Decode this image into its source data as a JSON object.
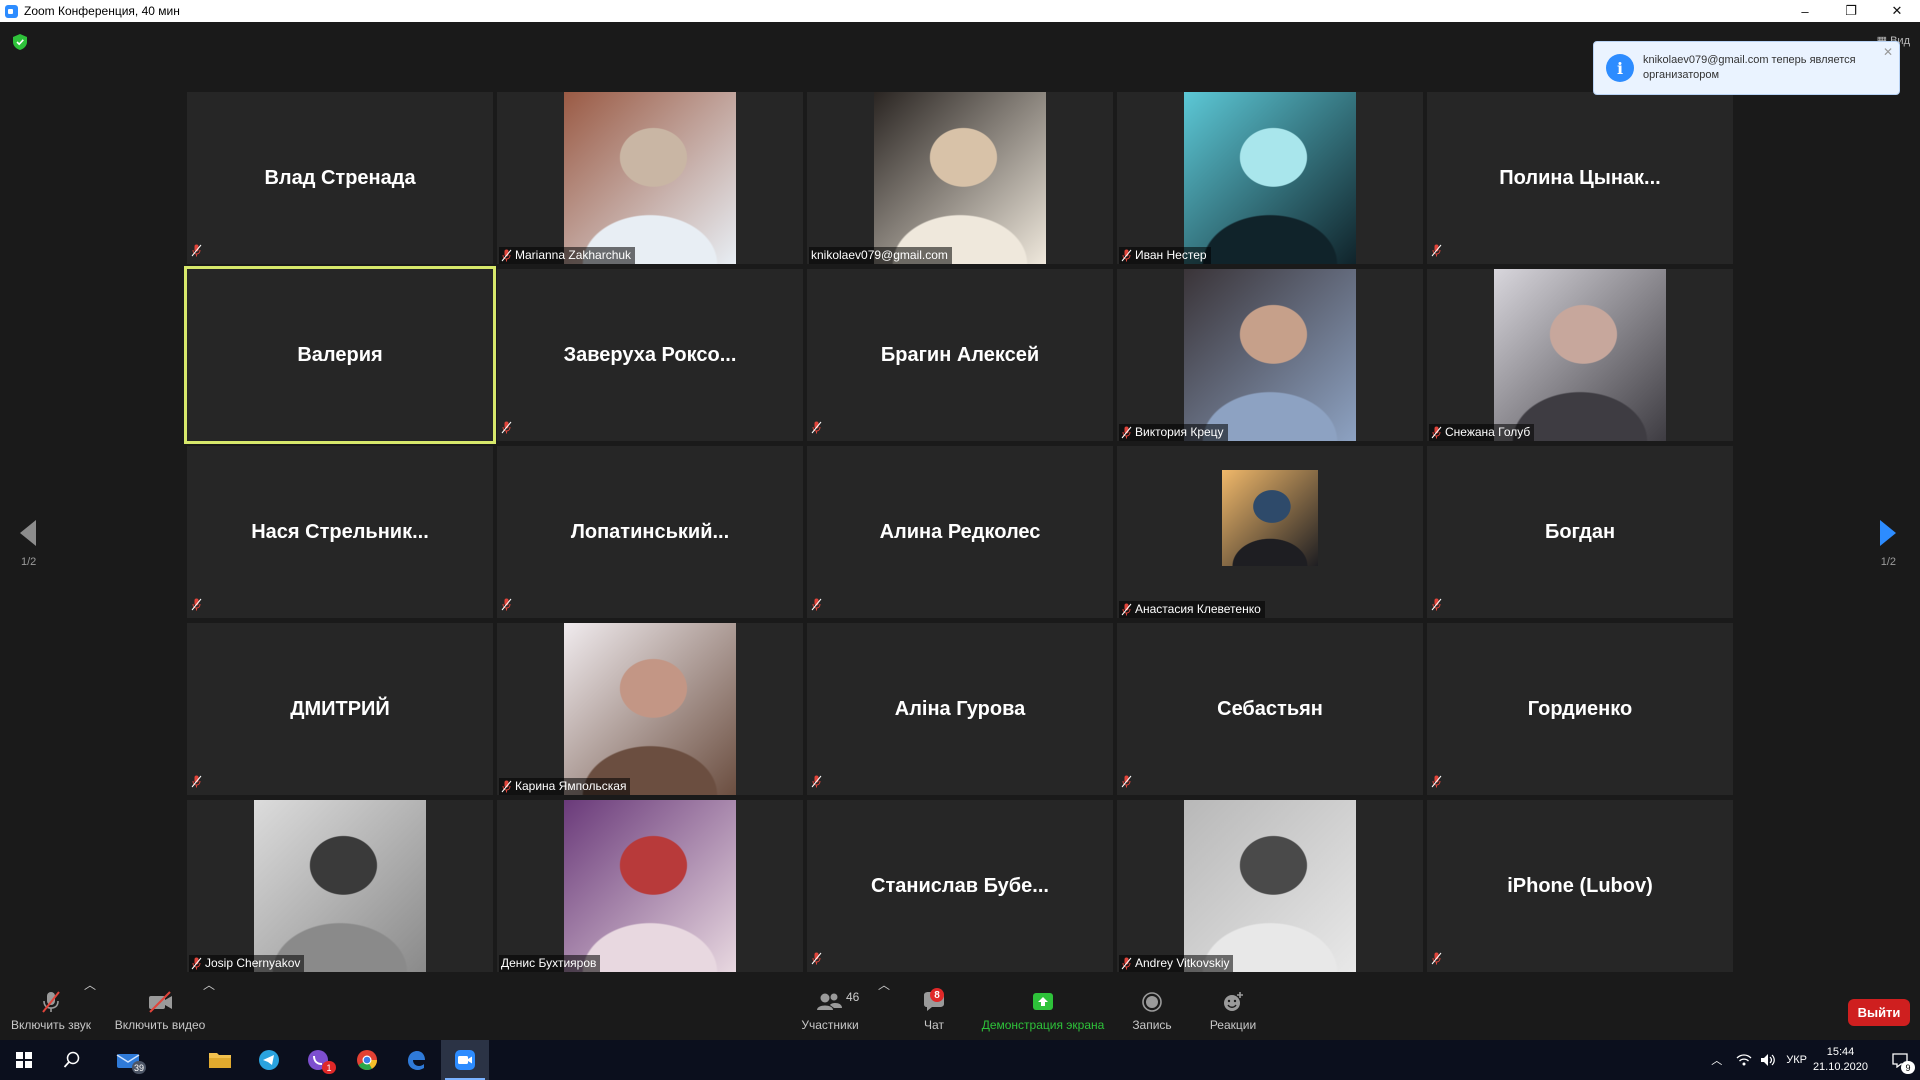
{
  "window": {
    "title": "Zoom Конференция, 40 мин",
    "controls": [
      "–",
      "❐",
      "✕"
    ]
  },
  "toast": {
    "message": "knikolaev079@gmail.com теперь является организатором",
    "close": "✕"
  },
  "view_button": "Вид",
  "pagination": {
    "left": "1/2",
    "right": "1/2"
  },
  "participants": [
    {
      "name": "Влад Стренада",
      "type": "name"
    },
    {
      "name": "Marianna Zakharchuk",
      "type": "photo",
      "palette": [
        "#9a5a44",
        "#c9b6a4",
        "#e8eef4"
      ]
    },
    {
      "name": "knikolaev079@gmail.com",
      "type": "photo",
      "palette": [
        "#2a2522",
        "#d8c2a8",
        "#efe8dc"
      ]
    },
    {
      "name": "Иван Нестер",
      "type": "photo",
      "palette": [
        "#5cc8d6",
        "#a9e6ec",
        "#10232a"
      ]
    },
    {
      "name": "Полина  Цынак...",
      "type": "name"
    },
    {
      "name": "Валерия",
      "type": "name",
      "active": true
    },
    {
      "name": "Заверуха  Роксо...",
      "type": "name"
    },
    {
      "name": "Брагин Алексей",
      "type": "name"
    },
    {
      "name": "Виктория Крецу",
      "type": "photo",
      "palette": [
        "#3a3438",
        "#c6a08a",
        "#8da2c2"
      ]
    },
    {
      "name": "Снежана Голуб",
      "type": "photo",
      "palette": [
        "#d8d6dc",
        "#c7a79c",
        "#3e3c42"
      ]
    },
    {
      "name": "Нася  Стрельник...",
      "type": "name"
    },
    {
      "name": "Лопатинський...",
      "type": "name"
    },
    {
      "name": "Алина Редколес",
      "type": "name"
    },
    {
      "name": "Анастасия Клеветенко",
      "type": "photo-small",
      "palette": [
        "#f0b86a",
        "#2e4a6a",
        "#1e1e22"
      ]
    },
    {
      "name": "Богдан",
      "type": "name"
    },
    {
      "name": "ДМИТРИЙ",
      "type": "name"
    },
    {
      "name": "Карина Ямпольская",
      "type": "photo",
      "palette": [
        "#f0ebee",
        "#c39685",
        "#6b4e40"
      ]
    },
    {
      "name": "Аліна Гурова",
      "type": "name"
    },
    {
      "name": "Себастьян",
      "type": "name"
    },
    {
      "name": "Гордиенко",
      "type": "name"
    },
    {
      "name": "Josip Chernyakov",
      "type": "photo",
      "palette": [
        "#dcdcdc",
        "#3a3a3a",
        "#8a8a8a"
      ]
    },
    {
      "name": "Денис Бухтияров",
      "type": "photo",
      "palette": [
        "#6a3a7a",
        "#b83a3a",
        "#e8d8e0"
      ]
    },
    {
      "name": "Станислав  Бубе...",
      "type": "name"
    },
    {
      "name": "Andrey Vitkovskiy",
      "type": "photo",
      "palette": [
        "#b8b8b8",
        "#4a4a4a",
        "#e8e8e8"
      ]
    },
    {
      "name": "iPhone (Lubov)",
      "type": "name"
    }
  ],
  "toolbar": {
    "unmute_label": "Включить звук",
    "start_video_label": "Включить видео",
    "participants_label": "Участники",
    "participants_count": "46",
    "chat_label": "Чат",
    "chat_badge": "8",
    "share_label": "Демонстрация экрана",
    "record_label": "Запись",
    "reactions_label": "Реакции",
    "leave_label": "Выйти"
  },
  "taskbar": {
    "mail_badge": "39",
    "viber_badge": "1",
    "language": "УКР",
    "time": "15:44",
    "date": "21.10.2020",
    "notifications_badge": "9"
  },
  "colors": {
    "accent_blue": "#2d8cff",
    "active_speaker": "#d7e86b",
    "leave_red": "#cf1f1f",
    "share_green": "#2ec23a",
    "muted_red": "#e0443a"
  }
}
